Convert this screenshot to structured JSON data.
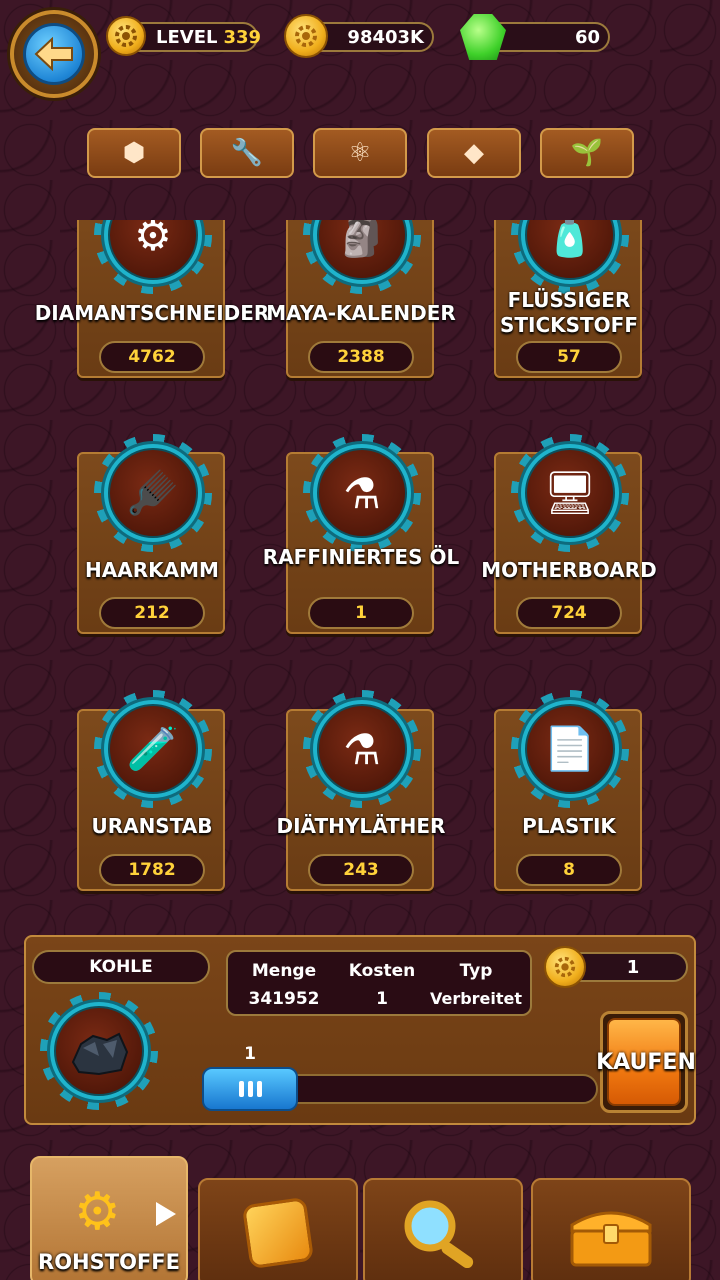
{
  "header": {
    "level_label": "LEVEL",
    "level_value": "339",
    "coins": "98403K",
    "gems": "60"
  },
  "categories": [
    {
      "icon": "rock-icon",
      "glyph": "⬢"
    },
    {
      "icon": "wrench-icon",
      "glyph": "🔧"
    },
    {
      "icon": "molecule-icon",
      "glyph": "⚛"
    },
    {
      "icon": "diamond-icon",
      "glyph": "◆"
    },
    {
      "icon": "plant-icon",
      "glyph": "🌱"
    }
  ],
  "items": [
    {
      "name": "DIAMANTSCHNEIDER",
      "quantity": "4762",
      "icon": "saw-blade-icon",
      "glyph": "⚙"
    },
    {
      "name": "MAYA-KALENDER",
      "quantity": "2388",
      "icon": "maya-calendar-icon",
      "glyph": "🗿"
    },
    {
      "name": "FLÜSSIGER STICKSTOFF",
      "quantity": "57",
      "icon": "nitrogen-bottle-icon",
      "glyph": "🧴"
    },
    {
      "name": "HAARKAMM",
      "quantity": "212",
      "icon": "hair-comb-icon",
      "glyph": "🪮"
    },
    {
      "name": "RAFFINIERTES ÖL",
      "quantity": "1",
      "icon": "oil-flask-icon",
      "glyph": "⚗"
    },
    {
      "name": "MOTHERBOARD",
      "quantity": "724",
      "icon": "motherboard-icon",
      "glyph": "🖥"
    },
    {
      "name": "URANSTAB",
      "quantity": "1782",
      "icon": "uranium-rod-icon",
      "glyph": "🧪"
    },
    {
      "name": "DIÄTHYLÄTHER",
      "quantity": "243",
      "icon": "ether-flask-icon",
      "glyph": "⚗"
    },
    {
      "name": "PLASTIK",
      "quantity": "8",
      "icon": "plastic-sheets-icon",
      "glyph": "📄"
    }
  ],
  "purchase": {
    "item_name": "KOHLE",
    "item_icon": "coal-icon",
    "columns": [
      "Menge",
      "Kosten",
      "Typ"
    ],
    "values": [
      "341952",
      "1",
      "Verbreitet"
    ],
    "price": "1",
    "slider_value": "1",
    "buy_label": "KAUFEN"
  },
  "nav": {
    "active_label": "ROHSTOFFE",
    "tabs": [
      {
        "icon": "gear-icon"
      },
      {
        "icon": "cube-icon"
      },
      {
        "icon": "magnifier-icon"
      },
      {
        "icon": "treasure-chest-icon"
      }
    ]
  }
}
